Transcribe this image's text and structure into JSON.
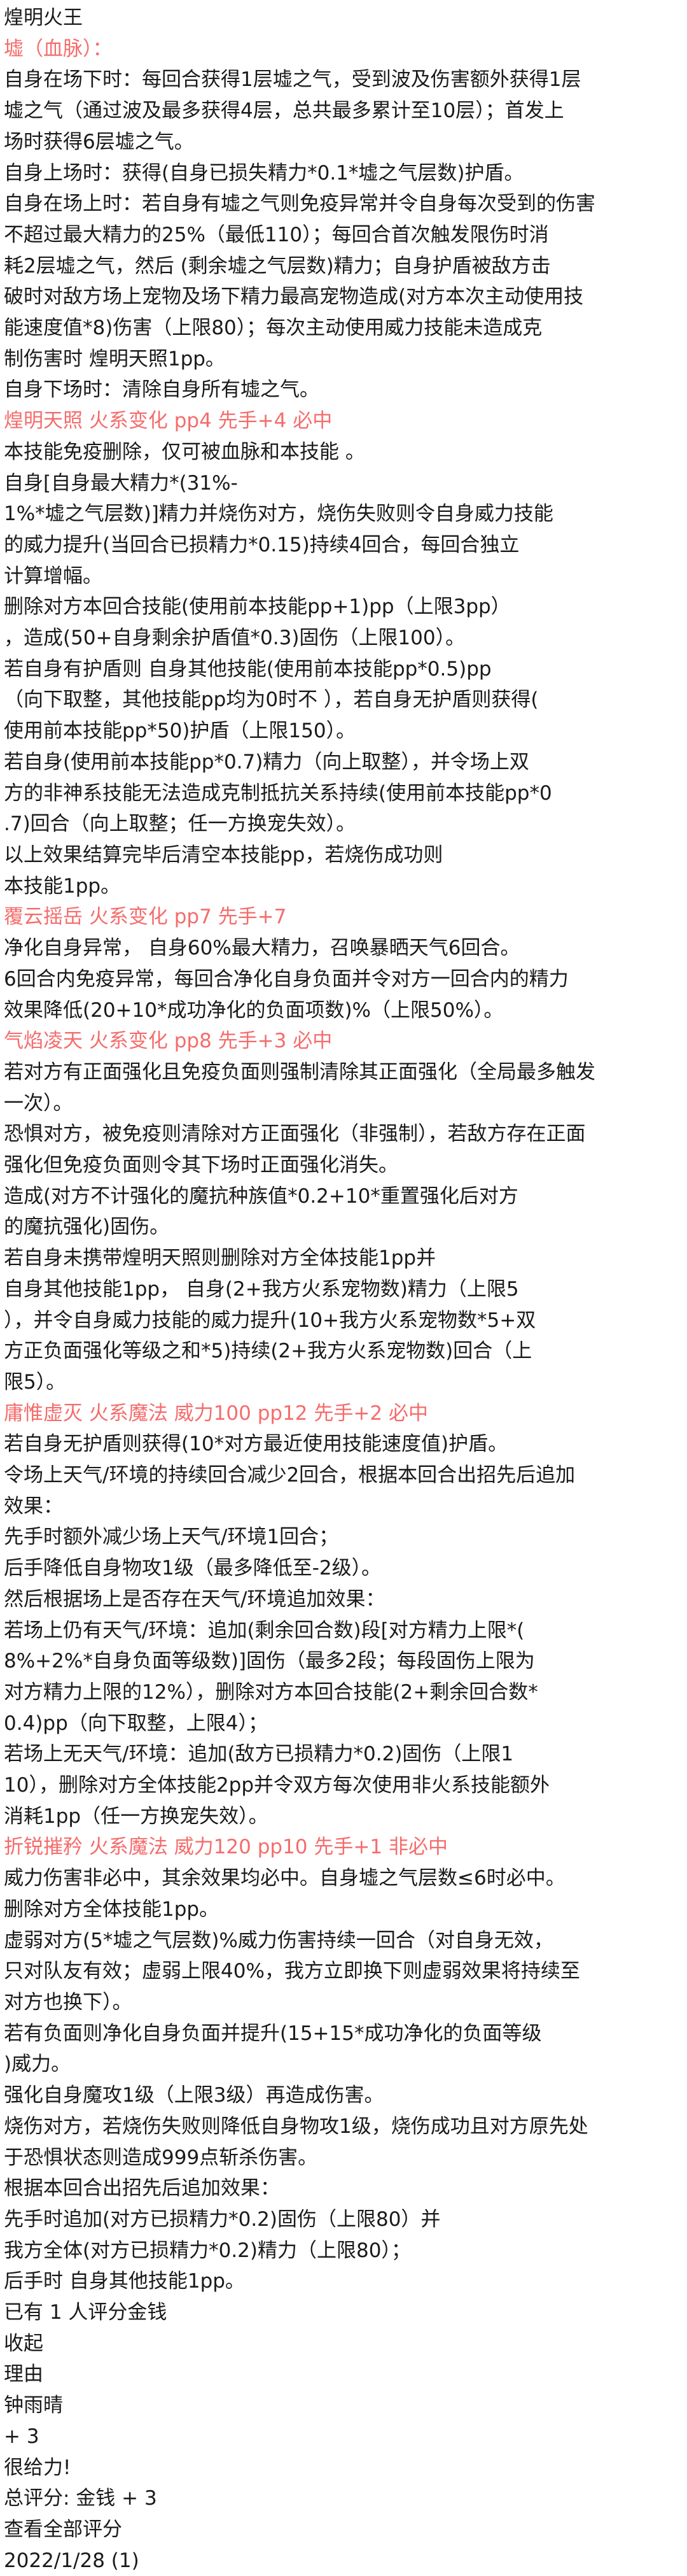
{
  "colors": {
    "text": "#1a1a1a",
    "highlight": "#f56c6c",
    "background": "#ffffff"
  },
  "post": {
    "lines": [
      {
        "text": "煌明火王",
        "style": "title"
      },
      {
        "text": "墟（血脉）：",
        "style": "red"
      },
      {
        "text": "自身在场下时：每回合获得1层墟之气，受到波及伤害额外获得1层",
        "style": ""
      },
      {
        "text": "墟之气（通过波及最多获得4层，总共最多累计至10层）；首发上",
        "style": ""
      },
      {
        "text": "场时获得6层墟之气。",
        "style": ""
      },
      {
        "text": "自身上场时：获得(自身已损失精力*0.1*墟之气层数)护盾。",
        "style": ""
      },
      {
        "text": "自身在场上时：若自身有墟之气则免疫异常并令自身每次受到的伤害",
        "style": ""
      },
      {
        "text": "不超过最大精力的25%（最低110）；每回合首次触发限伤时消",
        "style": ""
      },
      {
        "text": "耗2层墟之气，然后 (剩余墟之气层数)精力；自身护盾被敌方击",
        "style": ""
      },
      {
        "text": "破时对敌方场上宠物及场下精力最高宠物造成(对方本次主动使用技",
        "style": ""
      },
      {
        "text": "能速度值*8)伤害（上限80）；每次主动使用威力技能未造成克",
        "style": ""
      },
      {
        "text": "制伤害时 煌明天照1pp。",
        "style": ""
      },
      {
        "text": "自身下场时：清除自身所有墟之气。",
        "style": ""
      },
      {
        "text": "煌明天照 火系变化 pp4 先手+4 必中",
        "style": "red"
      },
      {
        "text": "本技能免疫删除，仅可被血脉和本技能 。",
        "style": ""
      },
      {
        "text": "自身[自身最大精力*(31%-",
        "style": ""
      },
      {
        "text": "1%*墟之气层数)]精力并烧伤对方，烧伤失败则令自身威力技能",
        "style": ""
      },
      {
        "text": "的威力提升(当回合已损精力*0.15)持续4回合，每回合独立",
        "style": ""
      },
      {
        "text": "计算增幅。",
        "style": ""
      },
      {
        "text": "删除对方本回合技能(使用前本技能pp+1)pp（上限3pp）",
        "style": ""
      },
      {
        "text": "，造成(50+自身剩余护盾值*0.3)固伤（上限100）。",
        "style": ""
      },
      {
        "text": "若自身有护盾则 自身其他技能(使用前本技能pp*0.5)pp",
        "style": ""
      },
      {
        "text": "（向下取整，其他技能pp均为0时不 ），若自身无护盾则获得(",
        "style": ""
      },
      {
        "text": "使用前本技能pp*50)护盾（上限150）。",
        "style": ""
      },
      {
        "text": "若自身(使用前本技能pp*0.7)精力（向上取整），并令场上双",
        "style": ""
      },
      {
        "text": "方的非神系技能无法造成克制抵抗关系持续(使用前本技能pp*0",
        "style": ""
      },
      {
        "text": ".7)回合（向上取整；任一方换宠失效）。",
        "style": ""
      },
      {
        "text": "以上效果结算完毕后清空本技能pp，若烧伤成功则",
        "style": ""
      },
      {
        "text": "本技能1pp。",
        "style": ""
      },
      {
        "text": "覆云摇岳 火系变化 pp7 先手+7",
        "style": "red"
      },
      {
        "text": "净化自身异常， 自身60%最大精力，召唤暴晒天气6回合。",
        "style": ""
      },
      {
        "text": "6回合内免疫异常，每回合净化自身负面并令对方一回合内的精力",
        "style": ""
      },
      {
        "text": "效果降低(20+10*成功净化的负面项数)%（上限50%）。",
        "style": ""
      },
      {
        "text": "气焰凌天 火系变化 pp8 先手+3 必中",
        "style": "red"
      },
      {
        "text": "若对方有正面强化且免疫负面则强制清除其正面强化（全局最多触发",
        "style": ""
      },
      {
        "text": "一次）。",
        "style": ""
      },
      {
        "text": "恐惧对方，被免疫则清除对方正面强化（非强制），若敌方存在正面",
        "style": ""
      },
      {
        "text": "强化但免疫负面则令其下场时正面强化消失。",
        "style": ""
      },
      {
        "text": "造成(对方不计强化的魔抗种族值*0.2+10*重置强化后对方",
        "style": ""
      },
      {
        "text": "的魔抗强化)固伤。",
        "style": ""
      },
      {
        "text": "若自身未携带煌明天照则删除对方全体技能1pp并",
        "style": ""
      },
      {
        "text": "自身其他技能1pp， 自身(2+我方火系宠物数)精力（上限5",
        "style": ""
      },
      {
        "text": "），并令自身威力技能的威力提升(10+我方火系宠物数*5+双",
        "style": ""
      },
      {
        "text": "方正负面强化等级之和*5)持续(2+我方火系宠物数)回合（上",
        "style": ""
      },
      {
        "text": "限5）。",
        "style": ""
      },
      {
        "text": "庸惟虚灭 火系魔法 威力100 pp12 先手+2 必中",
        "style": "red"
      },
      {
        "text": "若自身无护盾则获得(10*对方最近使用技能速度值)护盾。",
        "style": ""
      },
      {
        "text": "令场上天气/环境的持续回合减少2回合，根据本回合出招先后追加",
        "style": ""
      },
      {
        "text": "效果：",
        "style": ""
      },
      {
        "text": "先手时额外减少场上天气/环境1回合；",
        "style": ""
      },
      {
        "text": "后手降低自身物攻1级（最多降低至-2级）。",
        "style": ""
      },
      {
        "text": "然后根据场上是否存在天气/环境追加效果：",
        "style": ""
      },
      {
        "text": "若场上仍有天气/环境：追加(剩余回合数)段[对方精力上限*(",
        "style": ""
      },
      {
        "text": "8%+2%*自身负面等级数)]固伤（最多2段；每段固伤上限为",
        "style": ""
      },
      {
        "text": "对方精力上限的12%），删除对方本回合技能(2+剩余回合数*",
        "style": ""
      },
      {
        "text": "0.4)pp（向下取整，上限4）；",
        "style": ""
      },
      {
        "text": "若场上无天气/环境：追加(敌方已损精力*0.2)固伤（上限1",
        "style": ""
      },
      {
        "text": "10），删除对方全体技能2pp并令双方每次使用非火系技能额外",
        "style": ""
      },
      {
        "text": "消耗1pp（任一方换宠失效）。",
        "style": ""
      },
      {
        "text": "折锐摧矜 火系魔法 威力120 pp10 先手+1 非必中",
        "style": "red"
      },
      {
        "text": "威力伤害非必中，其余效果均必中。自身墟之气层数≤6时必中。",
        "style": ""
      },
      {
        "text": "删除对方全体技能1pp。",
        "style": ""
      },
      {
        "text": "虚弱对方(5*墟之气层数)%威力伤害持续一回合（对自身无效，",
        "style": ""
      },
      {
        "text": "只对队友有效；虚弱上限40%，我方立即换下则虚弱效果将持续至",
        "style": ""
      },
      {
        "text": "对方也换下）。",
        "style": ""
      },
      {
        "text": "若有负面则净化自身负面并提升(15+15*成功净化的负面等级",
        "style": ""
      },
      {
        "text": ")威力。",
        "style": ""
      },
      {
        "text": "强化自身魔攻1级（上限3级）再造成伤害。",
        "style": ""
      },
      {
        "text": "烧伤对方，若烧伤失败则降低自身物攻1级，烧伤成功且对方原先处",
        "style": ""
      },
      {
        "text": "于恐惧状态则造成999点斩杀伤害。",
        "style": ""
      },
      {
        "text": "根据本回合出招先后追加效果：",
        "style": ""
      },
      {
        "text": "先手时追加(对方已损精力*0.2)固伤（上限80）并",
        "style": ""
      },
      {
        "text": "我方全体(对方已损精力*0.2)精力（上限80）；",
        "style": ""
      },
      {
        "text": "后手时 自身其他技能1pp。",
        "style": ""
      }
    ]
  },
  "rating": {
    "summary": "已有 1 人评分金钱",
    "collapse_label": "收起",
    "reason_header": "理由",
    "rater_name": "钟雨晴",
    "score": "+ 3",
    "reason": "很给力!",
    "total": "总评分: 金钱 + 3",
    "view_all": "查看全部评分",
    "date": "2022/1/28 (1)"
  }
}
